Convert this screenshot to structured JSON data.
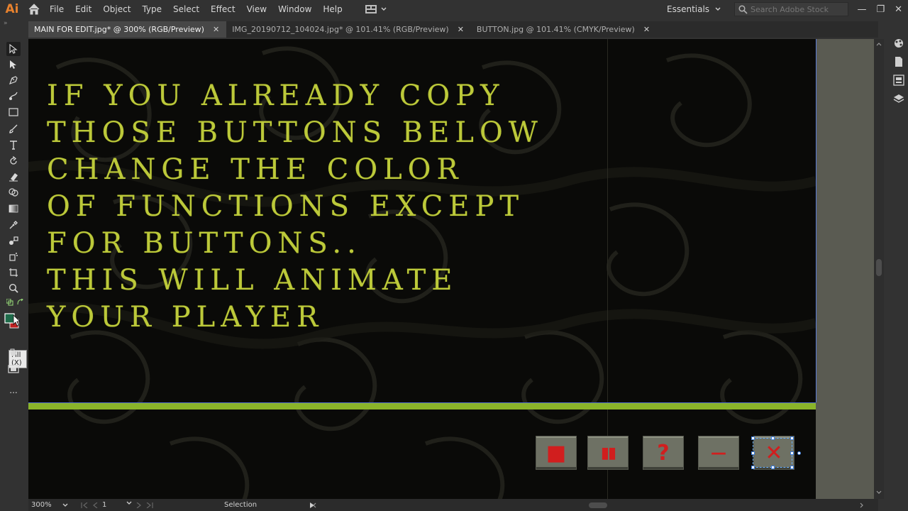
{
  "app": {
    "logo": "Ai"
  },
  "menu": [
    "File",
    "Edit",
    "Object",
    "Type",
    "Select",
    "Effect",
    "View",
    "Window",
    "Help"
  ],
  "workspace": {
    "label": "Essentials"
  },
  "stock_search": {
    "placeholder": "Search Adobe Stock"
  },
  "window_controls": {
    "minimize": "—",
    "restore": "❐",
    "close": "✕"
  },
  "tabs": [
    {
      "label": "MAIN FOR EDIT.jpg* @ 300% (RGB/Preview)",
      "close": "✕"
    },
    {
      "label": "IMG_20190712_104024.jpg* @ 101.41% (RGB/Preview)",
      "close": "✕"
    },
    {
      "label": "BUTTON.jpg @ 101.41% (CMYK/Preview)",
      "close": "✕"
    }
  ],
  "toolbar": {
    "collapse": "»",
    "tooltip": "Fill (X)",
    "more": "..."
  },
  "canvas": {
    "headline_lines": [
      "IF YOU ALREADY COPY",
      "THOSE BUTTONS BELOW",
      "CHANGE THE COLOR",
      "OF FUNCTIONS EXCEPT",
      "FOR BUTTONS..",
      "THIS WILL ANIMATE",
      "YOUR PLAYER"
    ],
    "text_color": "#bcc93a",
    "bar_color": "#8ab42a",
    "buttons": [
      {
        "name": "stop",
        "glyph": "■"
      },
      {
        "name": "pause",
        "glyph": "▮▮"
      },
      {
        "name": "help",
        "glyph": "?"
      },
      {
        "name": "minimize",
        "glyph": "—"
      },
      {
        "name": "close",
        "glyph": "✕"
      }
    ]
  },
  "statusbar": {
    "zoom": "300%",
    "artboard": "1",
    "tool": "Selection"
  }
}
